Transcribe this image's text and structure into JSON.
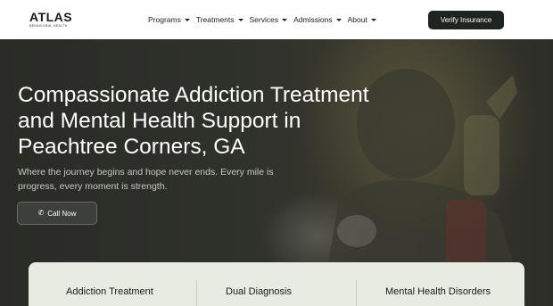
{
  "header": {
    "logo_text": "ATLAS",
    "logo_subtext": "BEHAVIORAL HEALTH",
    "nav": [
      {
        "label": "Programs"
      },
      {
        "label": "Treatments"
      },
      {
        "label": "Services"
      },
      {
        "label": "Admissions"
      },
      {
        "label": "About"
      }
    ],
    "verify_button": "Verify Insurance"
  },
  "hero": {
    "title": "Compassionate Addiction Treatment and Mental Health Support in Peachtree Corners, GA",
    "subtitle": "Where the journey begins and hope never ends. Every mile is progress, every moment is strength.",
    "call_button": "Call Now",
    "call_icon": "phone-icon"
  },
  "cards": [
    {
      "title": "Addiction Treatment"
    },
    {
      "title": "Dual Diagnosis"
    },
    {
      "title": "Mental Health Disorders"
    }
  ],
  "colors": {
    "header_bg": "#ffffff",
    "button_dark": "#1f2420",
    "hero_overlay": "#2f312b",
    "card_panel": "#e8ebe2"
  }
}
